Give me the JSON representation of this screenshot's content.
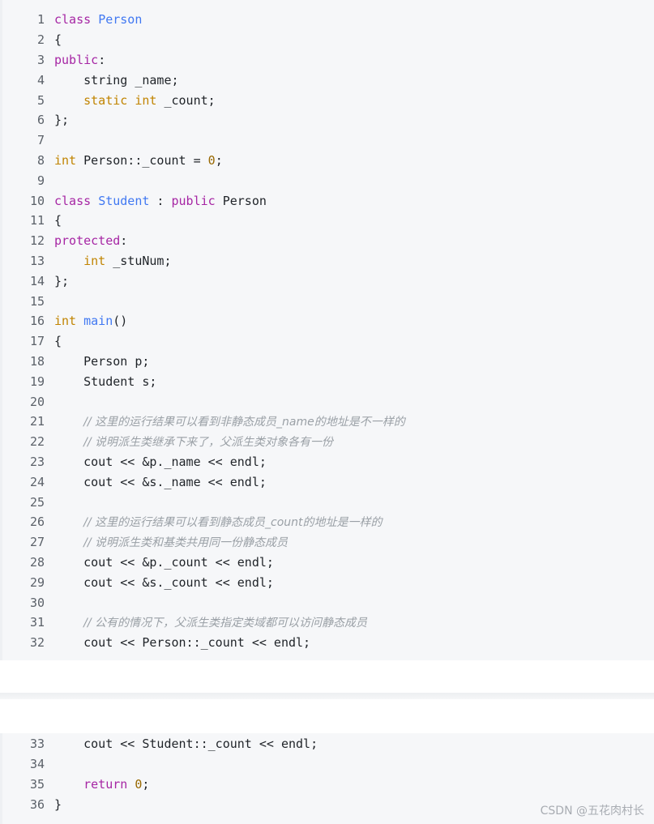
{
  "code": {
    "lines1": [
      {
        "n": "1",
        "t": [
          [
            "kw",
            "class"
          ],
          [
            "p",
            " "
          ],
          [
            "fn",
            "Person"
          ]
        ]
      },
      {
        "n": "2",
        "t": [
          [
            "p",
            "{"
          ]
        ]
      },
      {
        "n": "3",
        "t": [
          [
            "kw",
            "public"
          ],
          [
            "p",
            ":"
          ]
        ]
      },
      {
        "n": "4",
        "t": [
          [
            "p",
            "    string _name;"
          ]
        ]
      },
      {
        "n": "5",
        "t": [
          [
            "p",
            "    "
          ],
          [
            "ty",
            "static"
          ],
          [
            "p",
            " "
          ],
          [
            "ty",
            "int"
          ],
          [
            "p",
            " _count;"
          ]
        ]
      },
      {
        "n": "6",
        "t": [
          [
            "p",
            "};"
          ]
        ]
      },
      {
        "n": "7",
        "t": []
      },
      {
        "n": "8",
        "t": [
          [
            "ty",
            "int"
          ],
          [
            "p",
            " Person::_count = "
          ],
          [
            "num",
            "0"
          ],
          [
            "p",
            ";"
          ]
        ]
      },
      {
        "n": "9",
        "t": []
      },
      {
        "n": "10",
        "t": [
          [
            "kw",
            "class"
          ],
          [
            "p",
            " "
          ],
          [
            "fn",
            "Student"
          ],
          [
            "p",
            " : "
          ],
          [
            "kw",
            "public"
          ],
          [
            "p",
            " Person"
          ]
        ]
      },
      {
        "n": "11",
        "t": [
          [
            "p",
            "{"
          ]
        ]
      },
      {
        "n": "12",
        "t": [
          [
            "kw",
            "protected"
          ],
          [
            "p",
            ":"
          ]
        ]
      },
      {
        "n": "13",
        "t": [
          [
            "p",
            "    "
          ],
          [
            "ty",
            "int"
          ],
          [
            "p",
            " _stuNum;"
          ]
        ]
      },
      {
        "n": "14",
        "t": [
          [
            "p",
            "};"
          ]
        ]
      },
      {
        "n": "15",
        "t": []
      },
      {
        "n": "16",
        "t": [
          [
            "ty",
            "int"
          ],
          [
            "p",
            " "
          ],
          [
            "fn",
            "main"
          ],
          [
            "p",
            "()"
          ]
        ]
      },
      {
        "n": "17",
        "t": [
          [
            "p",
            "{"
          ]
        ]
      },
      {
        "n": "18",
        "t": [
          [
            "p",
            "    Person p;"
          ]
        ]
      },
      {
        "n": "19",
        "t": [
          [
            "p",
            "    Student s;"
          ]
        ]
      },
      {
        "n": "20",
        "t": []
      },
      {
        "n": "21",
        "t": [
          [
            "p",
            "    "
          ],
          [
            "cm",
            "// 这里的运行结果可以看到非静态成员_name的地址是不一样的"
          ]
        ]
      },
      {
        "n": "22",
        "t": [
          [
            "p",
            "    "
          ],
          [
            "cm",
            "// 说明派生类继承下来了，父派生类对象各有一份"
          ]
        ]
      },
      {
        "n": "23",
        "t": [
          [
            "p",
            "    cout << &p._name << endl;"
          ]
        ]
      },
      {
        "n": "24",
        "t": [
          [
            "p",
            "    cout << &s._name << endl;"
          ]
        ]
      },
      {
        "n": "25",
        "t": []
      },
      {
        "n": "26",
        "t": [
          [
            "p",
            "    "
          ],
          [
            "cm",
            "// 这里的运行结果可以看到静态成员_count的地址是一样的"
          ]
        ]
      },
      {
        "n": "27",
        "t": [
          [
            "p",
            "    "
          ],
          [
            "cm",
            "// 说明派生类和基类共用同一份静态成员"
          ]
        ]
      },
      {
        "n": "28",
        "t": [
          [
            "p",
            "    cout << &p._count << endl;"
          ]
        ]
      },
      {
        "n": "29",
        "t": [
          [
            "p",
            "    cout << &s._count << endl;"
          ]
        ]
      },
      {
        "n": "30",
        "t": []
      },
      {
        "n": "31",
        "t": [
          [
            "p",
            "    "
          ],
          [
            "cm",
            "// 公有的情况下，父派生类指定类域都可以访问静态成员"
          ]
        ]
      },
      {
        "n": "32",
        "t": [
          [
            "p",
            "    cout << Person::_count << endl;"
          ]
        ]
      }
    ],
    "lines2": [
      {
        "n": "33",
        "t": [
          [
            "p",
            "    cout << Student::_count << endl;"
          ]
        ]
      },
      {
        "n": "34",
        "t": []
      },
      {
        "n": "35",
        "t": [
          [
            "p",
            "    "
          ],
          [
            "kw",
            "return"
          ],
          [
            "p",
            " "
          ],
          [
            "num",
            "0"
          ],
          [
            "p",
            ";"
          ]
        ]
      },
      {
        "n": "36",
        "t": [
          [
            "p",
            "}"
          ]
        ]
      }
    ]
  },
  "watermark": "CSDN @五花肉村长",
  "colors": {
    "keyword": "#a626a4",
    "type": "#c18401",
    "function": "#4078f2",
    "number": "#986801",
    "comment": "#9aa0a6",
    "background": "#f6f7f9"
  }
}
